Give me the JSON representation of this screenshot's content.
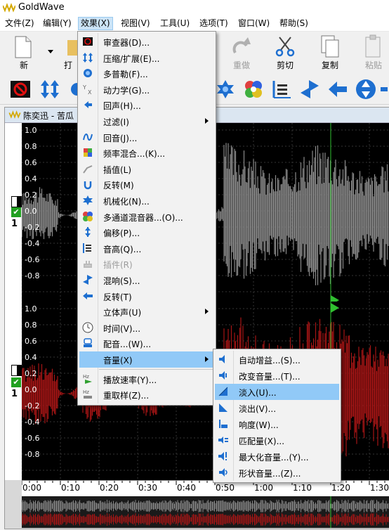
{
  "app": {
    "title": "GoldWave"
  },
  "menubar": [
    "文件(Z)",
    "编辑(Y)",
    "效果(X)",
    "视图(V)",
    "工具(U)",
    "选项(T)",
    "窗口(W)",
    "帮助(S)"
  ],
  "toolbar": {
    "new": "新",
    "open": "打",
    "redo": "重做",
    "cut": "剪切",
    "copy": "复制",
    "paste": "粘贴"
  },
  "document": {
    "title": "陈奕迅 - 苦瓜"
  },
  "y_axis_labels": [
    "1.0",
    "0.8",
    "0.6",
    "0.4",
    "0.2",
    "0.0",
    "-0.2",
    "-0.4",
    "-0.6",
    "-0.8"
  ],
  "channel_number": "1",
  "timeline": [
    "0:00",
    "0:10",
    "0:20",
    "0:30",
    "0:40",
    "0:50",
    "1:00",
    "1:10",
    "1:20",
    "1:30"
  ],
  "effects_menu": [
    {
      "label": "审查器(D)...",
      "icon": "examiner-icon"
    },
    {
      "label": "压缩/扩展(E)...",
      "icon": "compressor-icon"
    },
    {
      "label": "多普勒(F)...",
      "icon": "doppler-icon"
    },
    {
      "label": "动力学(G)...",
      "icon": "dynamics-icon"
    },
    {
      "label": "回声(H)...",
      "icon": "echo-icon"
    },
    {
      "label": "过滤(I)",
      "icon": "",
      "submenu": true
    },
    {
      "label": "回音(J)...",
      "icon": "flanger-icon"
    },
    {
      "label": "频率混合...(K)...",
      "icon": "freq-mix-icon"
    },
    {
      "label": "插值(L)",
      "icon": "interpolate-icon"
    },
    {
      "label": "反转(M)",
      "icon": "invert-icon"
    },
    {
      "label": "机械化(N)...",
      "icon": "mechanize-icon"
    },
    {
      "label": "多通道混音器...(O)...",
      "icon": "channel-mixer-icon"
    },
    {
      "label": "偏移(P)...",
      "icon": "offset-icon"
    },
    {
      "label": "音高(Q)...",
      "icon": "pitch-icon"
    },
    {
      "label": "插件(R)",
      "icon": "plugin-icon",
      "disabled": true
    },
    {
      "label": "混响(S)...",
      "icon": "reverb-icon"
    },
    {
      "label": "反转(T)",
      "icon": "reverse-icon"
    },
    {
      "label": "立体声(U)",
      "icon": "",
      "submenu": true
    },
    {
      "label": "时间(V)...",
      "icon": "clock-icon"
    },
    {
      "label": "配音...(W)...",
      "icon": "voiceover-icon"
    },
    {
      "label": "音量(X)",
      "icon": "",
      "submenu": true,
      "highlighted": true
    },
    {
      "label": "播放速率(Y)...",
      "icon": "playback-rate-icon"
    },
    {
      "label": "重取样(Z)...",
      "icon": "resample-icon"
    }
  ],
  "volume_submenu": [
    {
      "label": "自动增益...(S)...",
      "icon": "auto-gain-icon"
    },
    {
      "label": "改变音量...(T)...",
      "icon": "change-volume-icon"
    },
    {
      "label": "淡入(U)...",
      "icon": "fade-in-icon",
      "highlighted": true
    },
    {
      "label": "淡出(V)...",
      "icon": "fade-out-icon"
    },
    {
      "label": "响度(W)...",
      "icon": "loudness-icon"
    },
    {
      "label": "匹配量(X)...",
      "icon": "match-volume-icon"
    },
    {
      "label": "最大化音量...(Y)...",
      "icon": "maximize-volume-icon"
    },
    {
      "label": "形状音量...(Z)...",
      "icon": "shape-volume-icon"
    }
  ],
  "colors": {
    "menu_highlight": "#91c9f7",
    "wave_top": "#8a8a8a",
    "wave_bottom": "#a51515",
    "cursor": "#30c030"
  }
}
